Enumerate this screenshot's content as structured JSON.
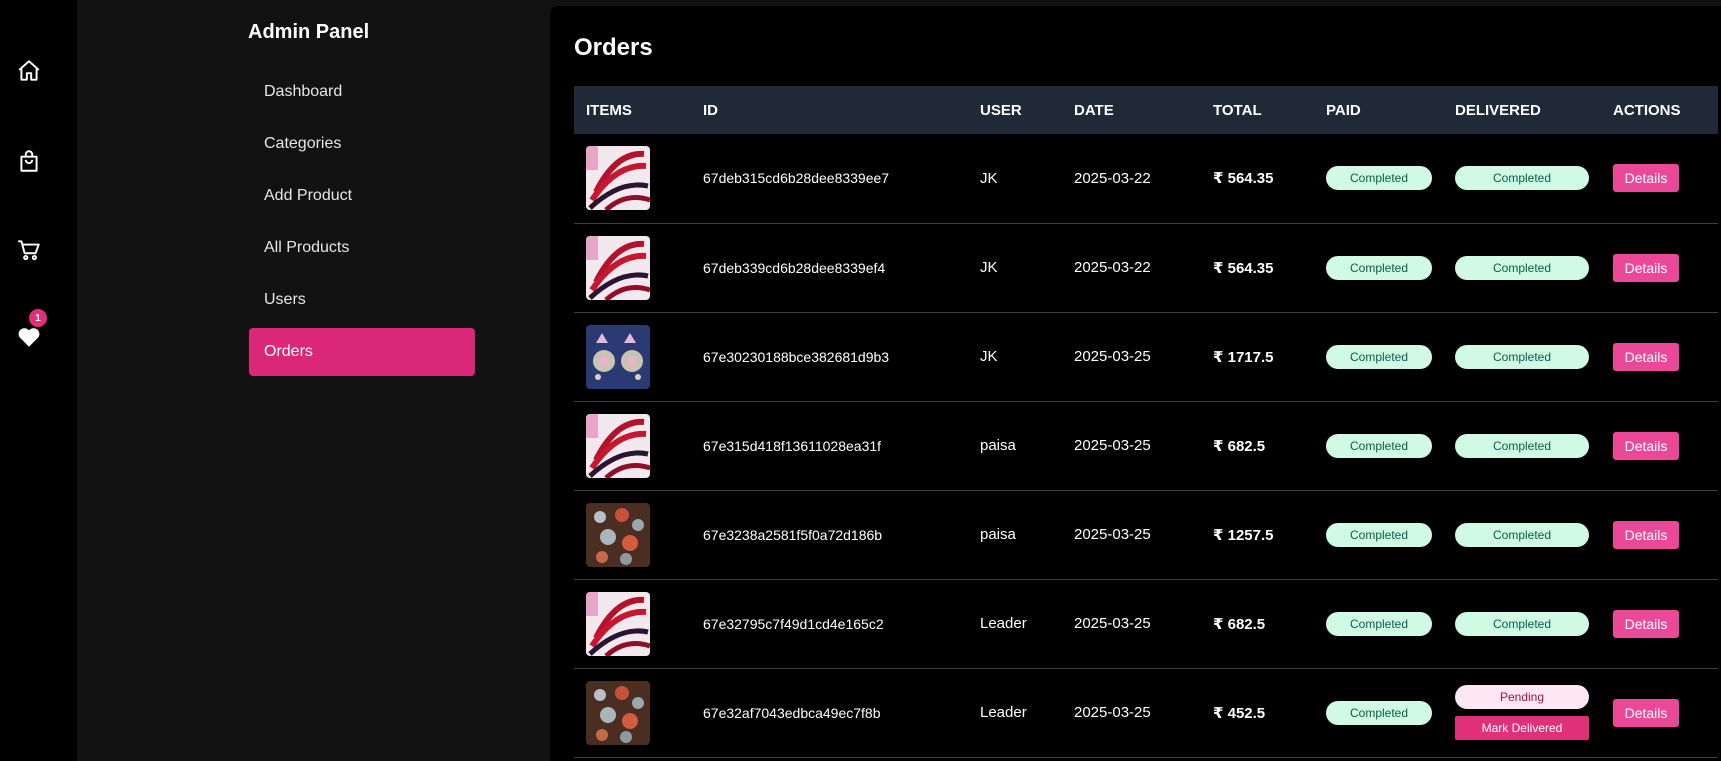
{
  "rail": {
    "icons": [
      "home-icon",
      "shopping-bag-icon",
      "cart-icon",
      "heart-icon"
    ],
    "favorites_count": "1"
  },
  "sidebar": {
    "title": "Admin Panel",
    "items": [
      {
        "label": "Dashboard"
      },
      {
        "label": "Categories"
      },
      {
        "label": "Add Product"
      },
      {
        "label": "All Products"
      },
      {
        "label": "Users"
      },
      {
        "label": "Orders"
      }
    ],
    "active": "Orders"
  },
  "main": {
    "title": "Orders",
    "columns": [
      "ITEMS",
      "ID",
      "USER",
      "DATE",
      "TOTAL",
      "PAID",
      "DELIVERED",
      "ACTIONS"
    ],
    "details_label": "Details",
    "mark_delivered_label": "Mark Delivered",
    "orders": [
      {
        "thumb": "red-beads",
        "id": "67deb315cd6b28dee8339ee7",
        "user": "JK",
        "date": "2025-03-22",
        "total": "₹ 564.35",
        "paid": "Completed",
        "delivered": "Completed"
      },
      {
        "thumb": "red-beads",
        "id": "67deb339cd6b28dee8339ef4",
        "user": "JK",
        "date": "2025-03-22",
        "total": "₹ 564.35",
        "paid": "Completed",
        "delivered": "Completed"
      },
      {
        "thumb": "earrings",
        "id": "67e30230188bce382681d9b3",
        "user": "JK",
        "date": "2025-03-25",
        "total": "₹ 1717.5",
        "paid": "Completed",
        "delivered": "Completed"
      },
      {
        "thumb": "red-beads",
        "id": "67e315d418f13611028ea31f",
        "user": "paisa",
        "date": "2025-03-25",
        "total": "₹ 682.5",
        "paid": "Completed",
        "delivered": "Completed"
      },
      {
        "thumb": "rings",
        "id": "67e3238a2581f5f0a72d186b",
        "user": "paisa",
        "date": "2025-03-25",
        "total": "₹ 1257.5",
        "paid": "Completed",
        "delivered": "Completed"
      },
      {
        "thumb": "red-beads",
        "id": "67e32795c7f49d1cd4e165c2",
        "user": "Leader",
        "date": "2025-03-25",
        "total": "₹ 682.5",
        "paid": "Completed",
        "delivered": "Completed"
      },
      {
        "thumb": "rings",
        "id": "67e32af7043edbca49ec7f8b",
        "user": "Leader",
        "date": "2025-03-25",
        "total": "₹ 452.5",
        "paid": "Completed",
        "delivered": "Pending"
      }
    ]
  },
  "colors": {
    "accent": "#db2777",
    "details_button": "#ec4899",
    "header_bg": "#1f2937",
    "completed_bg": "#d1fae5",
    "pending_bg": "#fce7f3"
  }
}
